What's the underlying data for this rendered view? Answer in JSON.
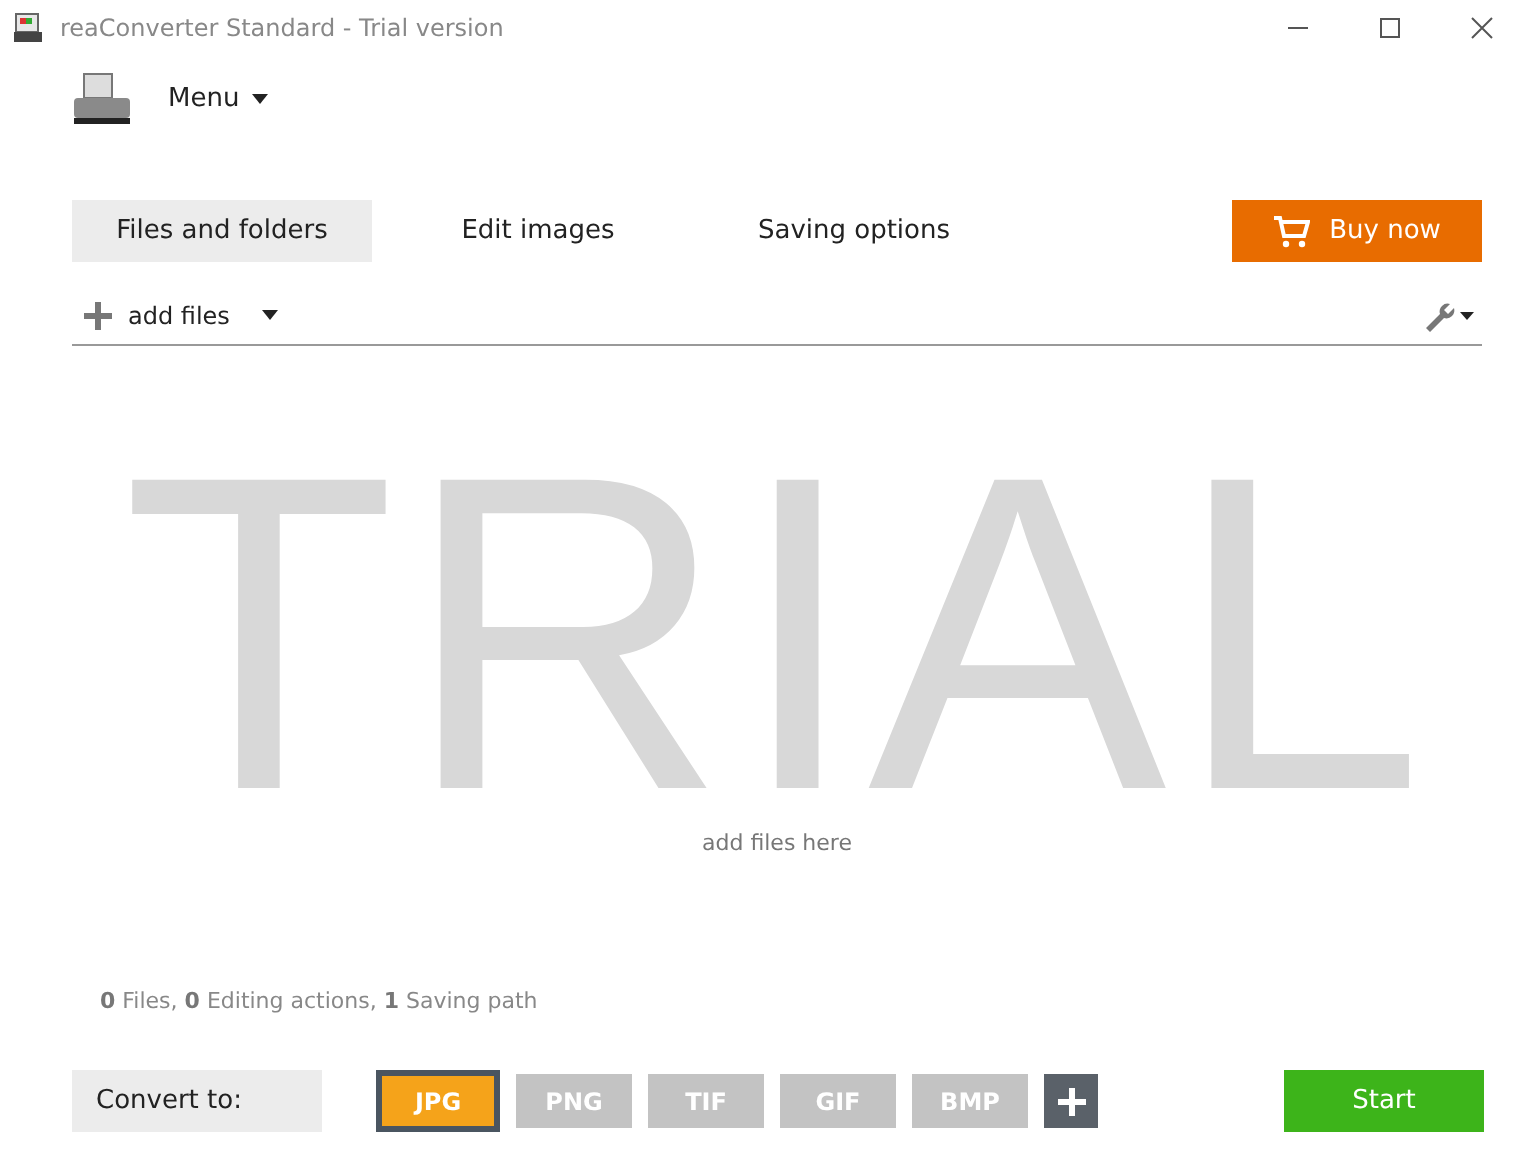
{
  "window": {
    "title": "reaConverter Standard - Trial version"
  },
  "menu": {
    "label": "Menu"
  },
  "tabs": [
    {
      "label": "Files and folders",
      "selected": true
    },
    {
      "label": "Edit images",
      "selected": false
    },
    {
      "label": "Saving options",
      "selected": false
    }
  ],
  "buy_button": {
    "label": "Buy now"
  },
  "toolbar": {
    "add_files": "add files"
  },
  "drop_area": {
    "watermark": "TRIAL",
    "hint": "add files here"
  },
  "status": "**0** Files, **0** Editing actions, **1** Saving path",
  "convert_to": {
    "label": "Convert to:"
  },
  "formats": [
    {
      "label": "JPG",
      "selected": true
    },
    {
      "label": "PNG",
      "selected": false
    },
    {
      "label": "TIF",
      "selected": false
    },
    {
      "label": "GIF",
      "selected": false
    },
    {
      "label": "BMP",
      "selected": false
    }
  ],
  "start_button": {
    "label": "Start"
  }
}
